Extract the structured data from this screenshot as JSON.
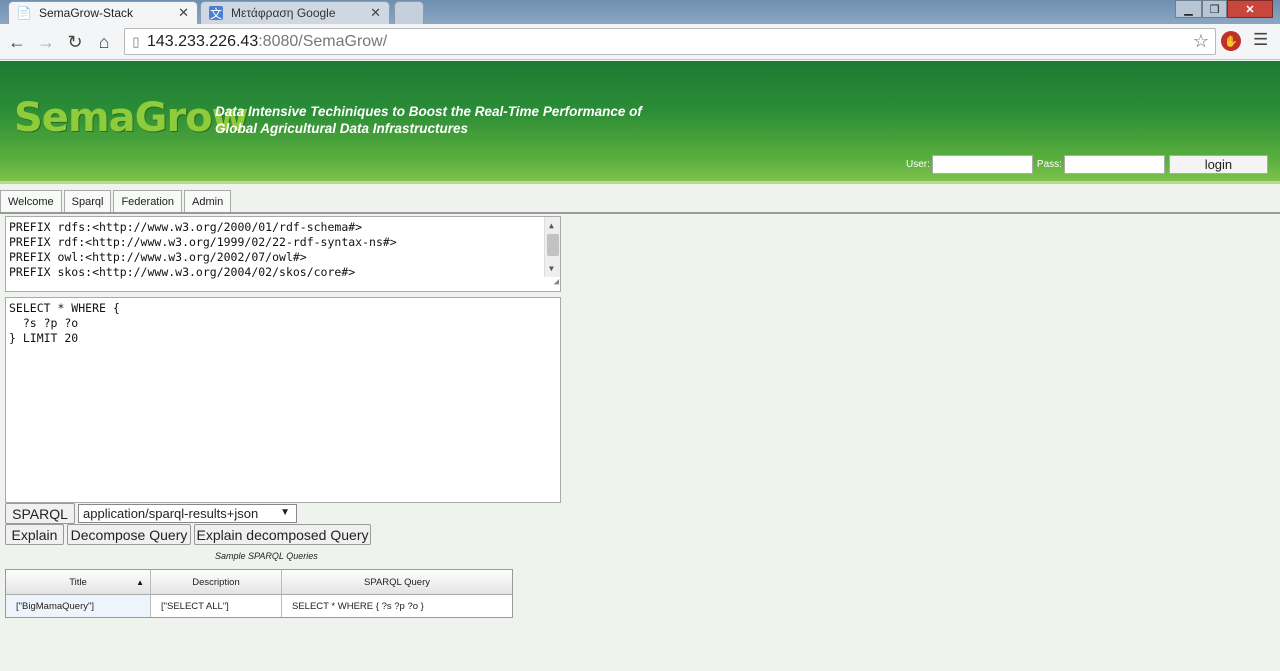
{
  "browser": {
    "tabs": [
      {
        "title": "SemaGrow-Stack",
        "icon": "page-icon"
      },
      {
        "title": "Μετάφραση Google",
        "icon": "google-translate-icon"
      }
    ],
    "url_host": "143.233.226.43",
    "url_path": ":8080/SemaGrow/"
  },
  "header": {
    "logo": "SemaGrow",
    "tagline_line1": "Data Intensive Techiniques to Boost the Real-Time Performance of",
    "tagline_line2": "Global Agricultural Data Infrastructures",
    "user_label": "User:",
    "pass_label": "Pass:",
    "login_label": "login"
  },
  "tabs": [
    "Welcome",
    "Sparql",
    "Federation",
    "Admin"
  ],
  "prefixes": [
    "PREFIX rdfs:<http://www.w3.org/2000/01/rdf-schema#>",
    "PREFIX rdf:<http://www.w3.org/1999/02/22-rdf-syntax-ns#>",
    "PREFIX owl:<http://www.w3.org/2002/07/owl#>",
    "PREFIX skos:<http://www.w3.org/2004/02/skos/core#>"
  ],
  "query": "SELECT * WHERE {\n  ?s ?p ?o\n} LIMIT 20",
  "controls": {
    "sparql_button": "SPARQL",
    "format_selected": "application/sparql-results+json",
    "explain_button": "Explain",
    "decompose_button": "Decompose Query",
    "explain_decomposed_button": "Explain decomposed Query"
  },
  "samples": {
    "caption": "Sample SPARQL Queries",
    "columns": [
      "Title",
      "Description",
      "SPARQL Query"
    ],
    "rows": [
      [
        "[\"BigMamaQuery\"]",
        "[\"SELECT ALL\"]",
        "SELECT * WHERE { ?s ?p ?o }"
      ]
    ]
  }
}
